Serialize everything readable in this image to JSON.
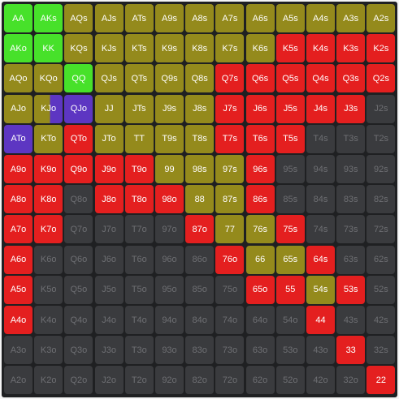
{
  "colors": {
    "raise": "#e41f1f",
    "call": "#948a1c",
    "strong": "#47e12a",
    "mix": "#5d36c2",
    "fold": "#3a3b3e"
  },
  "rows": [
    {
      "cells": [
        {
          "label": "AA",
          "action": "strong"
        },
        {
          "label": "AKs",
          "action": "strong"
        },
        {
          "label": "AQs",
          "action": "call"
        },
        {
          "label": "AJs",
          "action": "call"
        },
        {
          "label": "ATs",
          "action": "call"
        },
        {
          "label": "A9s",
          "action": "call"
        },
        {
          "label": "A8s",
          "action": "call"
        },
        {
          "label": "A7s",
          "action": "call"
        },
        {
          "label": "A6s",
          "action": "call"
        },
        {
          "label": "A5s",
          "action": "call"
        },
        {
          "label": "A4s",
          "action": "call"
        },
        {
          "label": "A3s",
          "action": "call"
        },
        {
          "label": "A2s",
          "action": "call"
        }
      ]
    },
    {
      "cells": [
        {
          "label": "AKo",
          "action": "strong"
        },
        {
          "label": "KK",
          "action": "strong"
        },
        {
          "label": "KQs",
          "action": "call"
        },
        {
          "label": "KJs",
          "action": "call"
        },
        {
          "label": "KTs",
          "action": "call"
        },
        {
          "label": "K9s",
          "action": "call"
        },
        {
          "label": "K8s",
          "action": "call"
        },
        {
          "label": "K7s",
          "action": "call"
        },
        {
          "label": "K6s",
          "action": "call"
        },
        {
          "label": "K5s",
          "action": "raise"
        },
        {
          "label": "K4s",
          "action": "raise"
        },
        {
          "label": "K3s",
          "action": "raise"
        },
        {
          "label": "K2s",
          "action": "raise"
        }
      ]
    },
    {
      "cells": [
        {
          "label": "AQo",
          "action": "call"
        },
        {
          "label": "KQo",
          "action": "call"
        },
        {
          "label": "QQ",
          "action": "strong"
        },
        {
          "label": "QJs",
          "action": "call"
        },
        {
          "label": "QTs",
          "action": "call"
        },
        {
          "label": "Q9s",
          "action": "call"
        },
        {
          "label": "Q8s",
          "action": "call"
        },
        {
          "label": "Q7s",
          "action": "raise"
        },
        {
          "label": "Q6s",
          "action": "raise"
        },
        {
          "label": "Q5s",
          "action": "raise"
        },
        {
          "label": "Q4s",
          "action": "raise"
        },
        {
          "label": "Q3s",
          "action": "raise"
        },
        {
          "label": "Q2s",
          "action": "raise"
        }
      ]
    },
    {
      "cells": [
        {
          "label": "AJo",
          "action": "call"
        },
        {
          "label": "KJo",
          "action": "split"
        },
        {
          "label": "QJo",
          "action": "mix"
        },
        {
          "label": "JJ",
          "action": "call"
        },
        {
          "label": "JTs",
          "action": "call"
        },
        {
          "label": "J9s",
          "action": "call"
        },
        {
          "label": "J8s",
          "action": "call"
        },
        {
          "label": "J7s",
          "action": "raise"
        },
        {
          "label": "J6s",
          "action": "raise"
        },
        {
          "label": "J5s",
          "action": "raise"
        },
        {
          "label": "J4s",
          "action": "raise"
        },
        {
          "label": "J3s",
          "action": "raise"
        },
        {
          "label": "J2s",
          "action": "fold"
        }
      ]
    },
    {
      "cells": [
        {
          "label": "ATo",
          "action": "mix"
        },
        {
          "label": "KTo",
          "action": "call"
        },
        {
          "label": "QTo",
          "action": "raise"
        },
        {
          "label": "JTo",
          "action": "call"
        },
        {
          "label": "TT",
          "action": "call"
        },
        {
          "label": "T9s",
          "action": "call"
        },
        {
          "label": "T8s",
          "action": "call"
        },
        {
          "label": "T7s",
          "action": "raise"
        },
        {
          "label": "T6s",
          "action": "raise"
        },
        {
          "label": "T5s",
          "action": "raise"
        },
        {
          "label": "T4s",
          "action": "fold"
        },
        {
          "label": "T3s",
          "action": "fold"
        },
        {
          "label": "T2s",
          "action": "fold"
        }
      ]
    },
    {
      "cells": [
        {
          "label": "A9o",
          "action": "raise"
        },
        {
          "label": "K9o",
          "action": "raise"
        },
        {
          "label": "Q9o",
          "action": "raise"
        },
        {
          "label": "J9o",
          "action": "raise"
        },
        {
          "label": "T9o",
          "action": "raise"
        },
        {
          "label": "99",
          "action": "call"
        },
        {
          "label": "98s",
          "action": "call"
        },
        {
          "label": "97s",
          "action": "call"
        },
        {
          "label": "96s",
          "action": "raise"
        },
        {
          "label": "95s",
          "action": "fold"
        },
        {
          "label": "94s",
          "action": "fold"
        },
        {
          "label": "93s",
          "action": "fold"
        },
        {
          "label": "92s",
          "action": "fold"
        }
      ]
    },
    {
      "cells": [
        {
          "label": "A8o",
          "action": "raise"
        },
        {
          "label": "K8o",
          "action": "raise"
        },
        {
          "label": "Q8o",
          "action": "fold"
        },
        {
          "label": "J8o",
          "action": "raise"
        },
        {
          "label": "T8o",
          "action": "raise"
        },
        {
          "label": "98o",
          "action": "raise"
        },
        {
          "label": "88",
          "action": "call"
        },
        {
          "label": "87s",
          "action": "call"
        },
        {
          "label": "86s",
          "action": "raise"
        },
        {
          "label": "85s",
          "action": "fold"
        },
        {
          "label": "84s",
          "action": "fold"
        },
        {
          "label": "83s",
          "action": "fold"
        },
        {
          "label": "82s",
          "action": "fold"
        }
      ]
    },
    {
      "cells": [
        {
          "label": "A7o",
          "action": "raise"
        },
        {
          "label": "K7o",
          "action": "raise"
        },
        {
          "label": "Q7o",
          "action": "fold"
        },
        {
          "label": "J7o",
          "action": "fold"
        },
        {
          "label": "T7o",
          "action": "fold"
        },
        {
          "label": "97o",
          "action": "fold"
        },
        {
          "label": "87o",
          "action": "raise"
        },
        {
          "label": "77",
          "action": "call"
        },
        {
          "label": "76s",
          "action": "call"
        },
        {
          "label": "75s",
          "action": "raise"
        },
        {
          "label": "74s",
          "action": "fold"
        },
        {
          "label": "73s",
          "action": "fold"
        },
        {
          "label": "72s",
          "action": "fold"
        }
      ]
    },
    {
      "cells": [
        {
          "label": "A6o",
          "action": "raise"
        },
        {
          "label": "K6o",
          "action": "fold"
        },
        {
          "label": "Q6o",
          "action": "fold"
        },
        {
          "label": "J6o",
          "action": "fold"
        },
        {
          "label": "T6o",
          "action": "fold"
        },
        {
          "label": "96o",
          "action": "fold"
        },
        {
          "label": "86o",
          "action": "fold"
        },
        {
          "label": "76o",
          "action": "raise"
        },
        {
          "label": "66",
          "action": "call"
        },
        {
          "label": "65s",
          "action": "call"
        },
        {
          "label": "64s",
          "action": "raise"
        },
        {
          "label": "63s",
          "action": "fold"
        },
        {
          "label": "62s",
          "action": "fold"
        }
      ]
    },
    {
      "cells": [
        {
          "label": "A5o",
          "action": "raise"
        },
        {
          "label": "K5o",
          "action": "fold"
        },
        {
          "label": "Q5o",
          "action": "fold"
        },
        {
          "label": "J5o",
          "action": "fold"
        },
        {
          "label": "T5o",
          "action": "fold"
        },
        {
          "label": "95o",
          "action": "fold"
        },
        {
          "label": "85o",
          "action": "fold"
        },
        {
          "label": "75o",
          "action": "fold"
        },
        {
          "label": "65o",
          "action": "raise"
        },
        {
          "label": "55",
          "action": "raise"
        },
        {
          "label": "54s",
          "action": "call"
        },
        {
          "label": "53s",
          "action": "raise"
        },
        {
          "label": "52s",
          "action": "fold"
        }
      ]
    },
    {
      "cells": [
        {
          "label": "A4o",
          "action": "raise"
        },
        {
          "label": "K4o",
          "action": "fold"
        },
        {
          "label": "Q4o",
          "action": "fold"
        },
        {
          "label": "J4o",
          "action": "fold"
        },
        {
          "label": "T4o",
          "action": "fold"
        },
        {
          "label": "94o",
          "action": "fold"
        },
        {
          "label": "84o",
          "action": "fold"
        },
        {
          "label": "74o",
          "action": "fold"
        },
        {
          "label": "64o",
          "action": "fold"
        },
        {
          "label": "54o",
          "action": "fold"
        },
        {
          "label": "44",
          "action": "raise"
        },
        {
          "label": "43s",
          "action": "fold"
        },
        {
          "label": "42s",
          "action": "fold"
        }
      ]
    },
    {
      "cells": [
        {
          "label": "A3o",
          "action": "fold"
        },
        {
          "label": "K3o",
          "action": "fold"
        },
        {
          "label": "Q3o",
          "action": "fold"
        },
        {
          "label": "J3o",
          "action": "fold"
        },
        {
          "label": "T3o",
          "action": "fold"
        },
        {
          "label": "93o",
          "action": "fold"
        },
        {
          "label": "83o",
          "action": "fold"
        },
        {
          "label": "73o",
          "action": "fold"
        },
        {
          "label": "63o",
          "action": "fold"
        },
        {
          "label": "53o",
          "action": "fold"
        },
        {
          "label": "43o",
          "action": "fold"
        },
        {
          "label": "33",
          "action": "raise"
        },
        {
          "label": "32s",
          "action": "fold"
        }
      ]
    },
    {
      "cells": [
        {
          "label": "A2o",
          "action": "fold"
        },
        {
          "label": "K2o",
          "action": "fold"
        },
        {
          "label": "Q2o",
          "action": "fold"
        },
        {
          "label": "J2o",
          "action": "fold"
        },
        {
          "label": "T2o",
          "action": "fold"
        },
        {
          "label": "92o",
          "action": "fold"
        },
        {
          "label": "82o",
          "action": "fold"
        },
        {
          "label": "72o",
          "action": "fold"
        },
        {
          "label": "62o",
          "action": "fold"
        },
        {
          "label": "52o",
          "action": "fold"
        },
        {
          "label": "42o",
          "action": "fold"
        },
        {
          "label": "32o",
          "action": "fold"
        },
        {
          "label": "22",
          "action": "raise"
        }
      ]
    }
  ]
}
